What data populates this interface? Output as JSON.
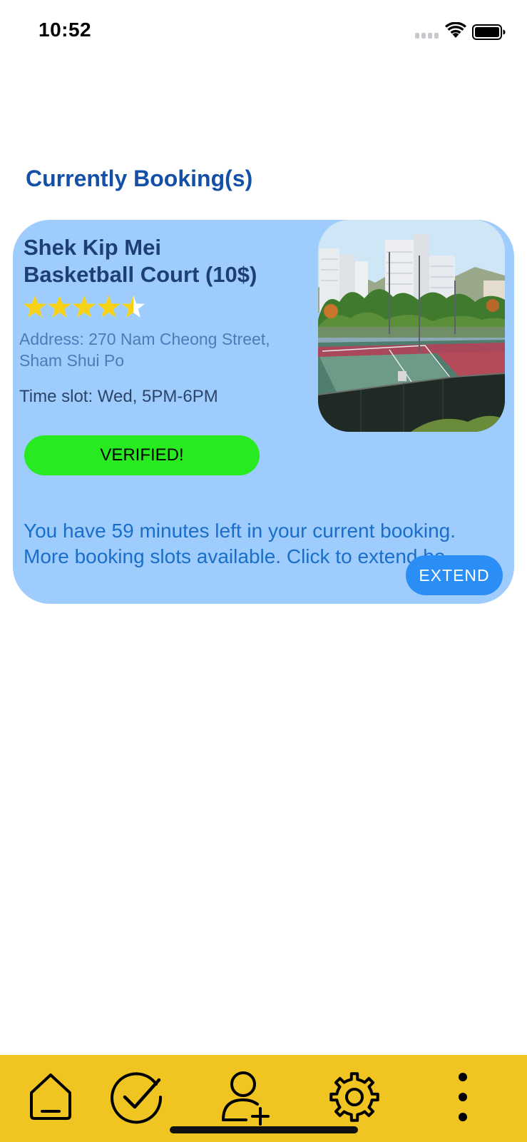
{
  "status_bar": {
    "time": "10:52"
  },
  "page": {
    "section_title": "Currently Booking(s)"
  },
  "booking": {
    "court_name_line1": "Shek Kip Mei",
    "court_name_line2": "Basketball Court (10$)",
    "rating": 4.5,
    "rating_max": 5,
    "address_line1": "Address: 270 Nam Cheong Street,",
    "address_line2": "Sham Shui Po",
    "time_slot": "Time slot: Wed, 5PM-6PM",
    "status_label": "VERIFIED!",
    "message_line1": "You have 59 minutes left in your current booking.",
    "message_line2": "More booking slots available. Click to extend be",
    "extend_label": "EXTEND"
  },
  "tab_bar": {
    "items": [
      {
        "icon": "home-icon"
      },
      {
        "icon": "check-circle-icon"
      },
      {
        "icon": "add-user-icon"
      },
      {
        "icon": "gear-icon"
      },
      {
        "icon": "more-vertical-icon"
      }
    ]
  },
  "colors": {
    "card_background": "#9ecdfd",
    "verified_green": "#27ea20",
    "extend_blue": "#2b8ef6",
    "tab_bar_yellow": "#f1c521",
    "title_blue": "#1450a8",
    "star_gold": "#f7d117"
  }
}
